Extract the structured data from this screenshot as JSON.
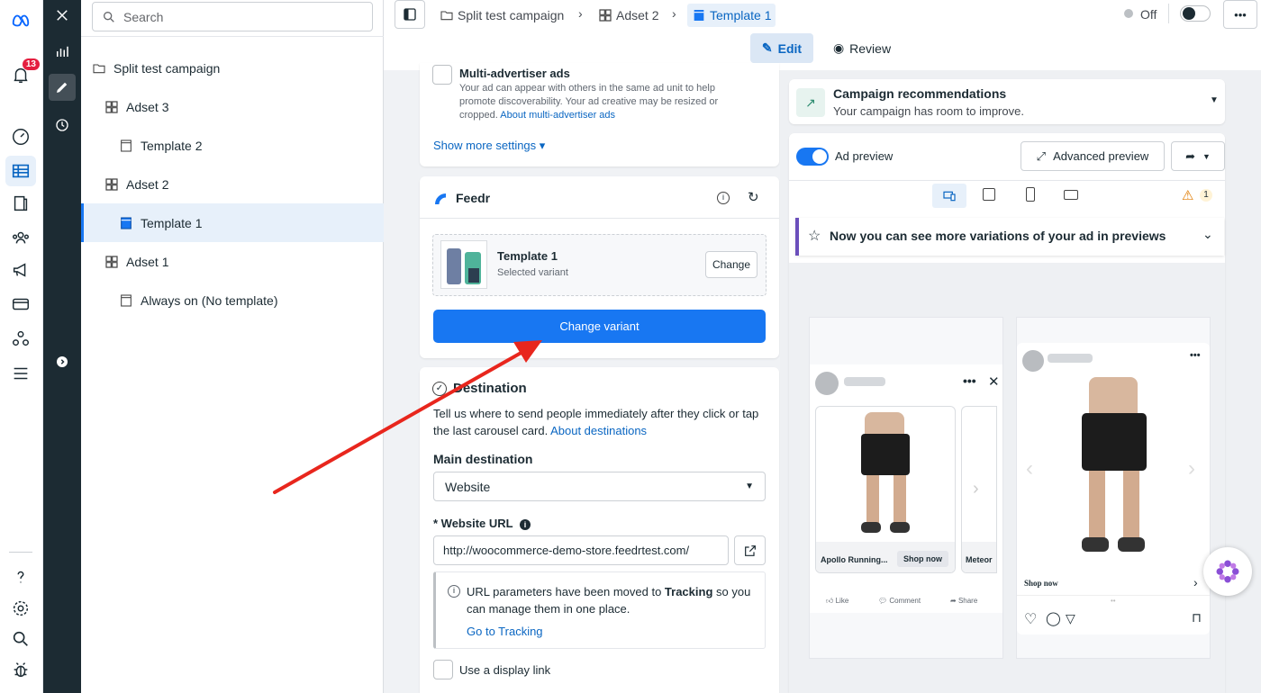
{
  "rail": {
    "notif_count": "13"
  },
  "tree": {
    "search_placeholder": "Search",
    "items": [
      {
        "label": "Split test campaign"
      },
      {
        "label": "Adset 3"
      },
      {
        "label": "Template 2"
      },
      {
        "label": "Adset 2"
      },
      {
        "label": "Template 1"
      },
      {
        "label": "Adset 1"
      },
      {
        "label": "Always on (No template)"
      }
    ]
  },
  "breadcrumb": {
    "c1": "Split test campaign",
    "c2": "Adset 2",
    "c3": "Template 1"
  },
  "toggle": {
    "label": "Off"
  },
  "modes": {
    "edit": "Edit",
    "review": "Review"
  },
  "settings": {
    "multi_title": "Multi-advertiser ads",
    "multi_desc": "Your ad can appear with others in the same ad unit to help promote discoverability. Your ad creative may be resized or cropped.",
    "multi_link": "About multi-advertiser ads",
    "show_more": "Show more settings ▾"
  },
  "feedr": {
    "title": "Feedr",
    "template_name": "Template 1",
    "template_sub": "Selected variant",
    "change_btn": "Change",
    "change_variant_btn": "Change variant"
  },
  "destination": {
    "title": "Destination",
    "desc": "Tell us where to send people immediately after they click or tap the last carousel card.",
    "desc_link": "About destinations",
    "main_label": "Main destination",
    "main_value": "Website",
    "url_label": "* Website URL",
    "url_value": "http://woocommerce-demo-store.feedrtest.com/",
    "info_pre": "URL parameters have been moved to ",
    "info_bold": "Tracking",
    "info_post": " so you can manage them in one place.",
    "info_link": "Go to Tracking",
    "display_link": "Use a display link"
  },
  "recs": {
    "title": "Campaign recommendations",
    "sub": "Your campaign has room to improve."
  },
  "preview": {
    "label": "Ad preview",
    "advanced": "Advanced preview",
    "warning_count": "1",
    "banner": "Now you can see more variations of your ad in previews",
    "fb_card1": "Apollo Running...",
    "fb_shop": "Shop now",
    "fb_card2": "Meteor",
    "fb_like": "Like",
    "fb_comment": "Comment",
    "fb_share": "Share",
    "ig_shop": "Shop now"
  },
  "colors": {
    "accent": "#1877f2",
    "annotation_arrow": "#e8261d"
  }
}
